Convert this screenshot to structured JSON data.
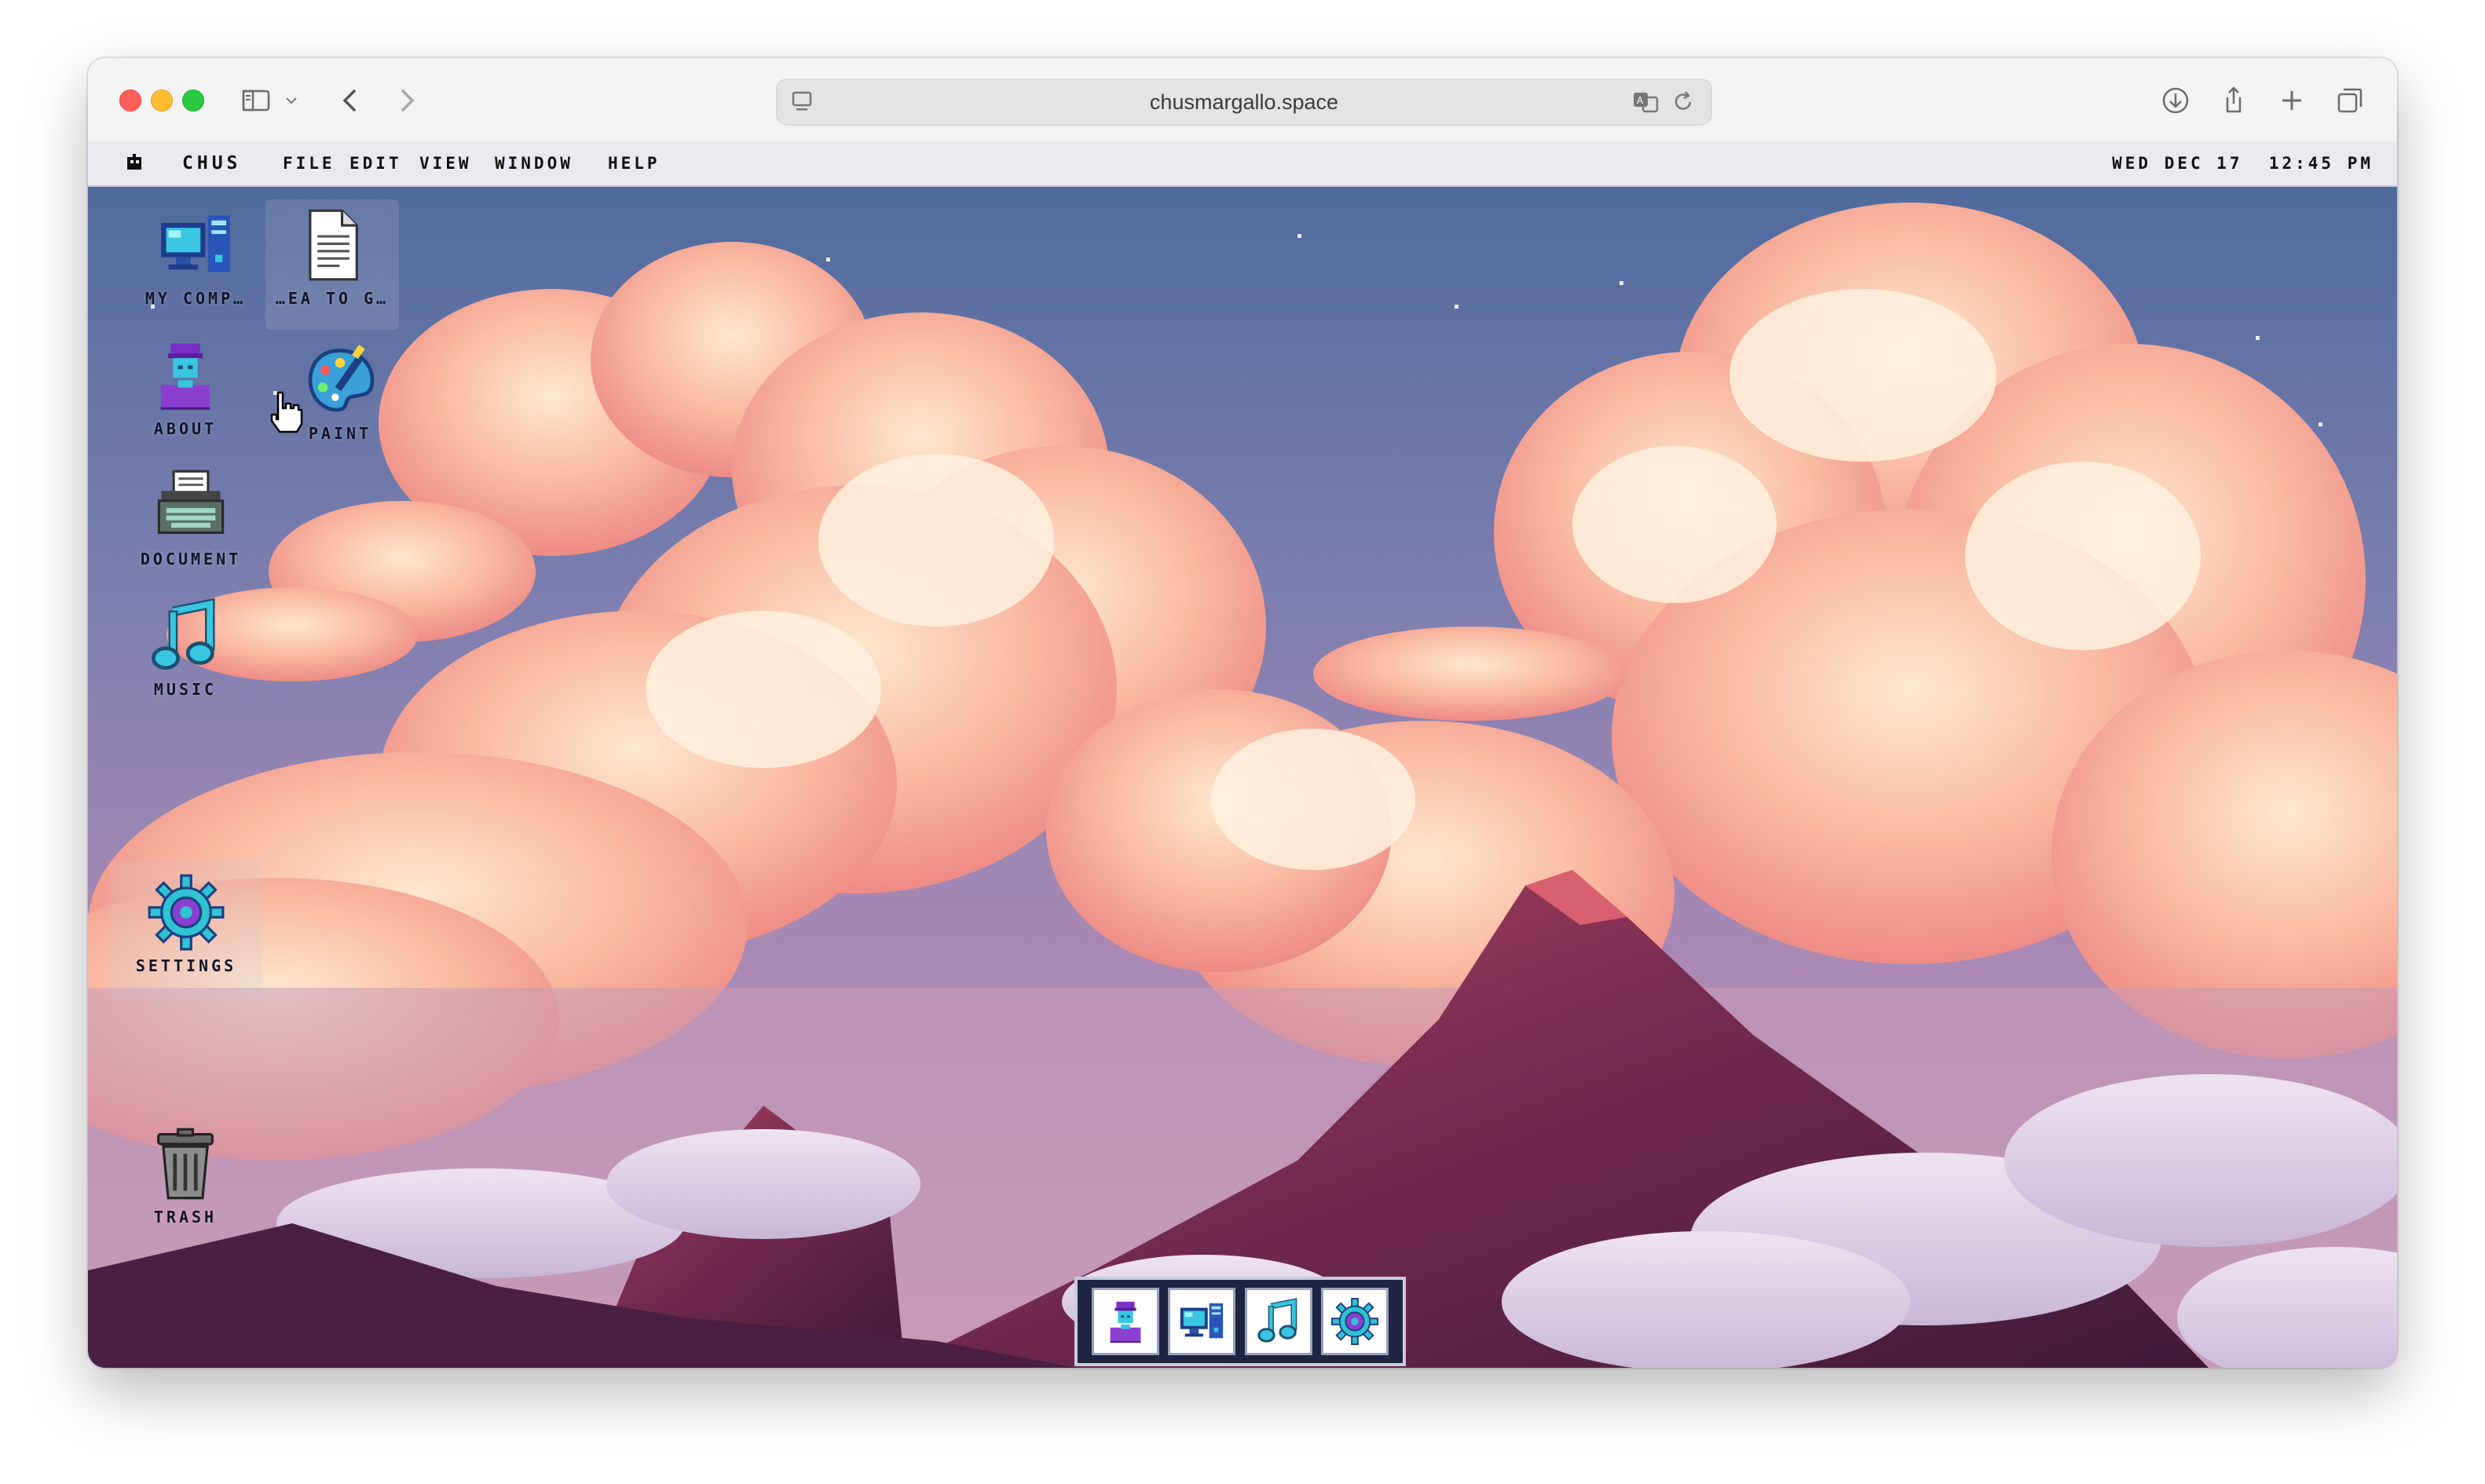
{
  "browser": {
    "url": "chusmargallo.space",
    "toolbar_icons": [
      "sidebar-icon",
      "chevron-down-icon",
      "back-icon",
      "forward-icon",
      "download-icon",
      "share-icon",
      "new-tab-icon",
      "tab-overview-icon"
    ]
  },
  "menubar": {
    "logo_icon": "apple-icon",
    "brand": "CHUS",
    "items": [
      {
        "label": "FILE"
      },
      {
        "label": "EDIT"
      },
      {
        "label": "VIEW"
      },
      {
        "label": "WINDOW"
      },
      {
        "label": "HELP"
      }
    ],
    "clock": "WED DEC 17  12:45 PM"
  },
  "desktop_icons": [
    {
      "label": "MY COMP…",
      "icon": "computer-icon"
    },
    {
      "label": "…EA TO G…",
      "icon": "text-file-icon"
    },
    {
      "label": "ABOUT",
      "icon": "user-icon"
    },
    {
      "label": "PAINT",
      "icon": "palette-icon"
    },
    {
      "label": "DOCUMENT",
      "icon": "typewriter-icon"
    },
    {
      "label": "MUSIC",
      "icon": "music-note-icon"
    },
    {
      "label": "SETTINGS",
      "icon": "gear-icon"
    },
    {
      "label": "TRASH",
      "icon": "trash-icon"
    }
  ],
  "dock": [
    {
      "icon": "user-icon"
    },
    {
      "icon": "computer-icon"
    },
    {
      "icon": "music-note-icon"
    },
    {
      "icon": "gear-icon"
    }
  ],
  "colors": {
    "accent_cyan": "#2fc3d3",
    "accent_purple": "#8a3fd1",
    "sky_top": "#5d78a6",
    "cloud_pink": "#f49a8d",
    "mountain": "#6b2a4a"
  }
}
